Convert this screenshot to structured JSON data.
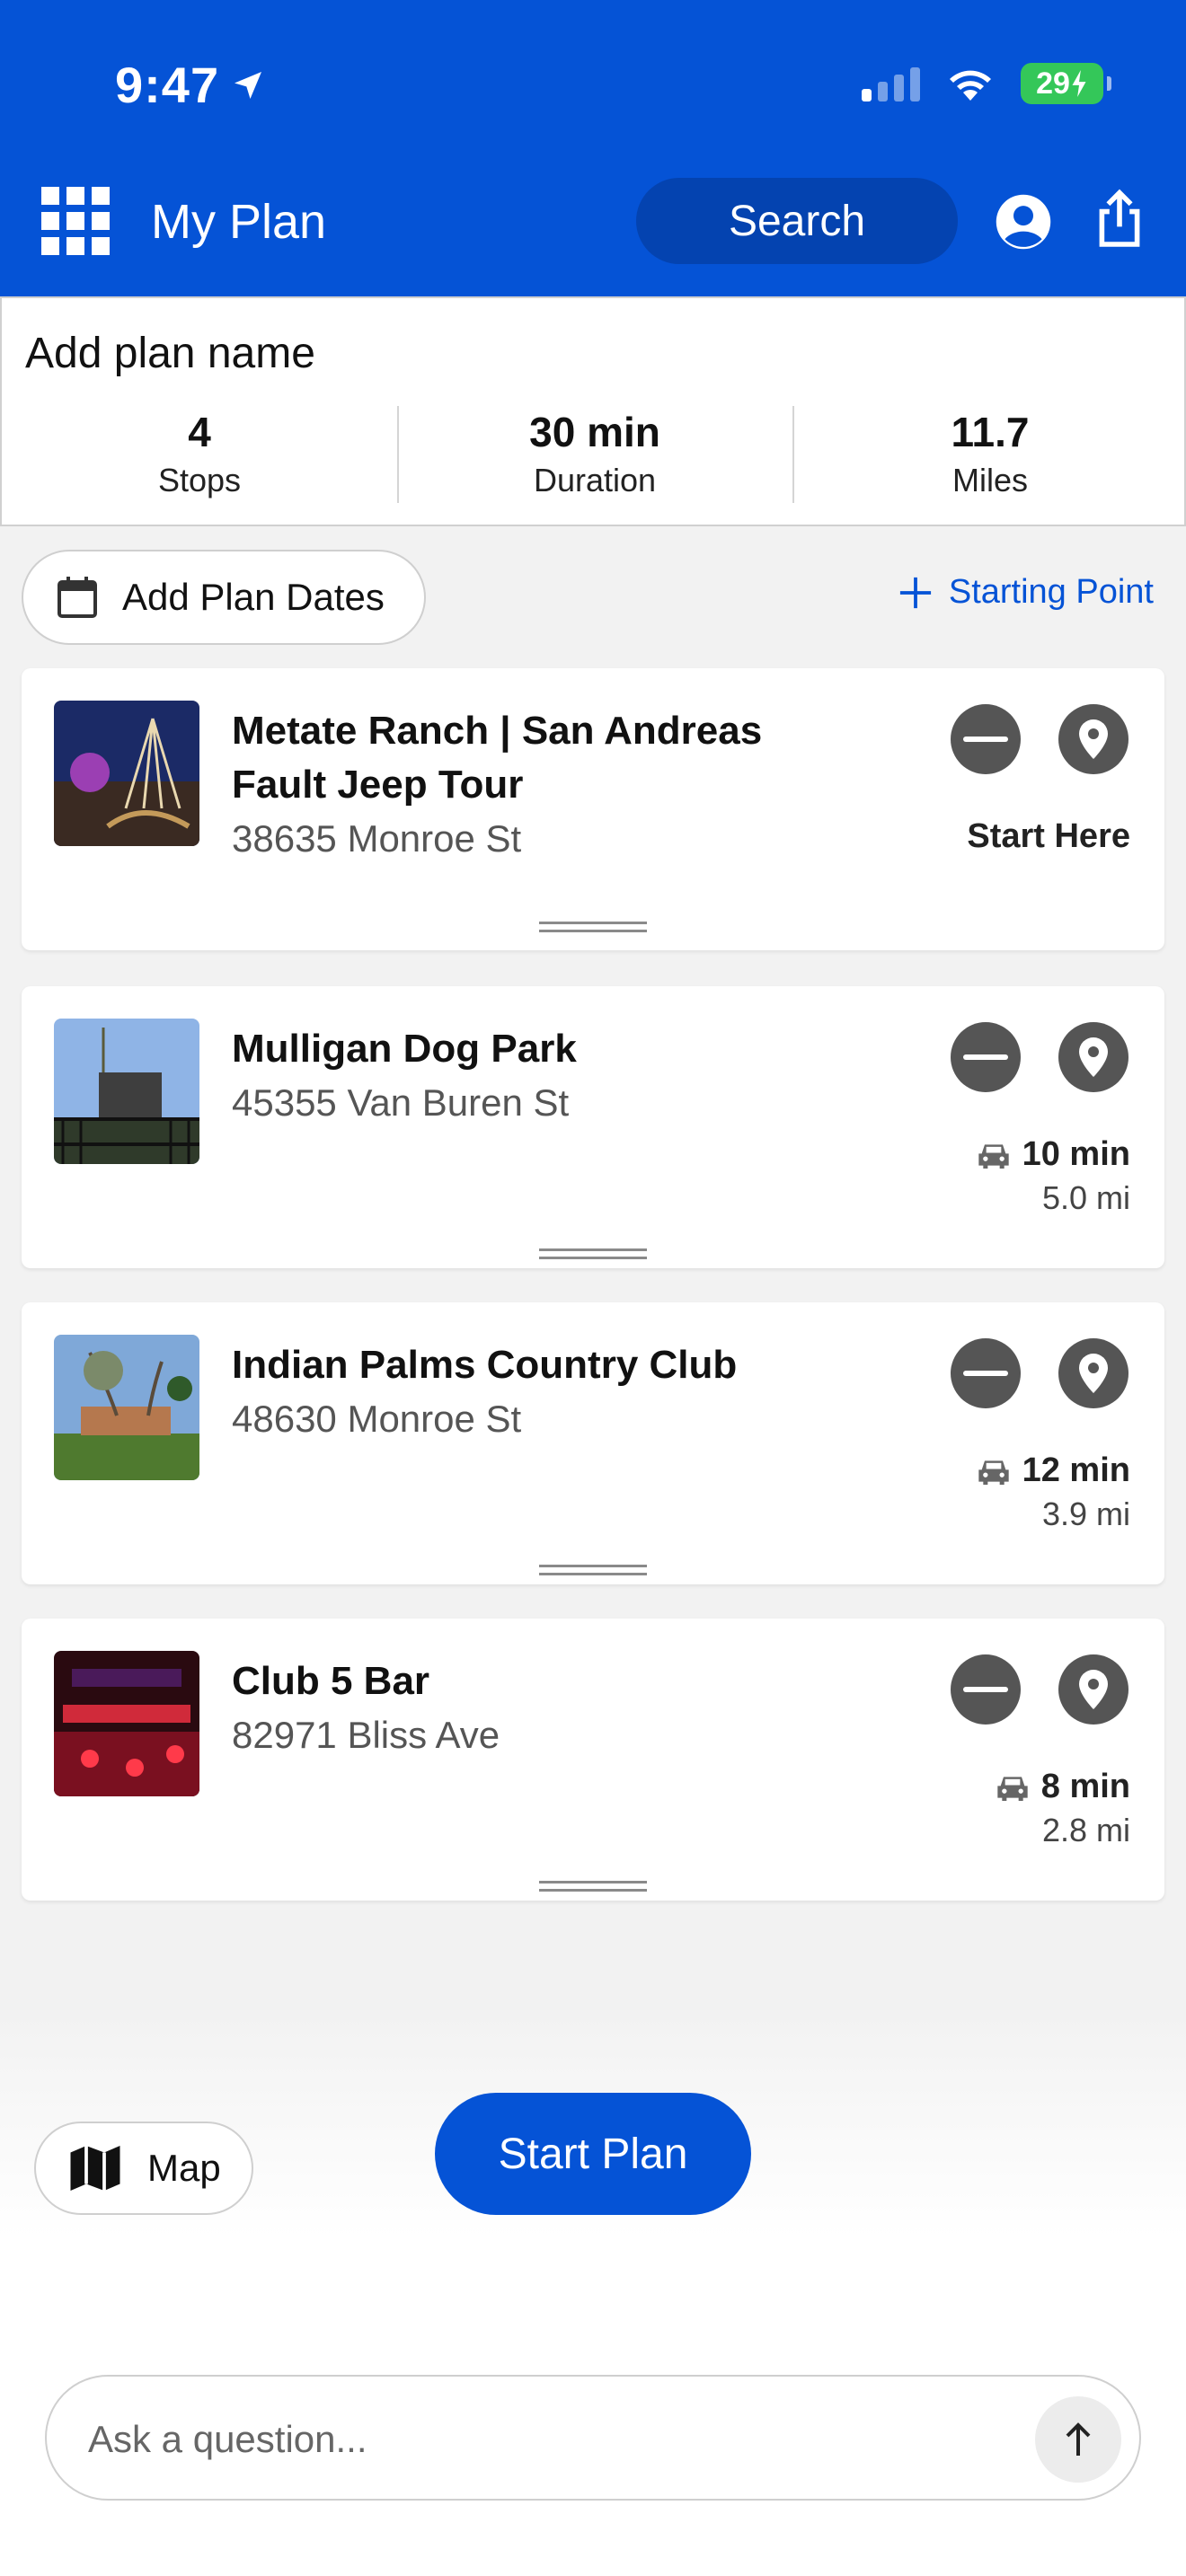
{
  "status_bar": {
    "time": "9:47",
    "battery": "29"
  },
  "header": {
    "title": "My Plan",
    "search_label": "Search"
  },
  "summary": {
    "plan_name": "Add plan name",
    "stats": [
      {
        "value": "4",
        "label": "Stops"
      },
      {
        "value": "30 min",
        "label": "Duration"
      },
      {
        "value": "11.7",
        "label": "Miles"
      }
    ]
  },
  "actions": {
    "add_dates_label": "Add Plan Dates",
    "starting_point_label": "Starting Point"
  },
  "stops": [
    {
      "name": "Metate Ranch | San Andreas Fault Jeep Tour",
      "address": "38635 Monroe St",
      "start_label": "Start Here"
    },
    {
      "name": "Mulligan Dog Park",
      "address": "45355 Van Buren St",
      "drive_time": "10 min",
      "distance": "5.0 mi"
    },
    {
      "name": "Indian Palms Country Club",
      "address": "48630 Monroe St",
      "drive_time": "12 min",
      "distance": "3.9 mi"
    },
    {
      "name": "Club 5 Bar",
      "address": "82971 Bliss Ave",
      "drive_time": "8 min",
      "distance": "2.8 mi"
    }
  ],
  "footer": {
    "map_label": "Map",
    "start_plan_label": "Start Plan",
    "ask_placeholder": "Ask a question..."
  },
  "colors": {
    "brand_blue": "#0553d6",
    "dark_blue": "#0443b0",
    "icon_gray": "#555555",
    "battery_green": "#34c759"
  }
}
